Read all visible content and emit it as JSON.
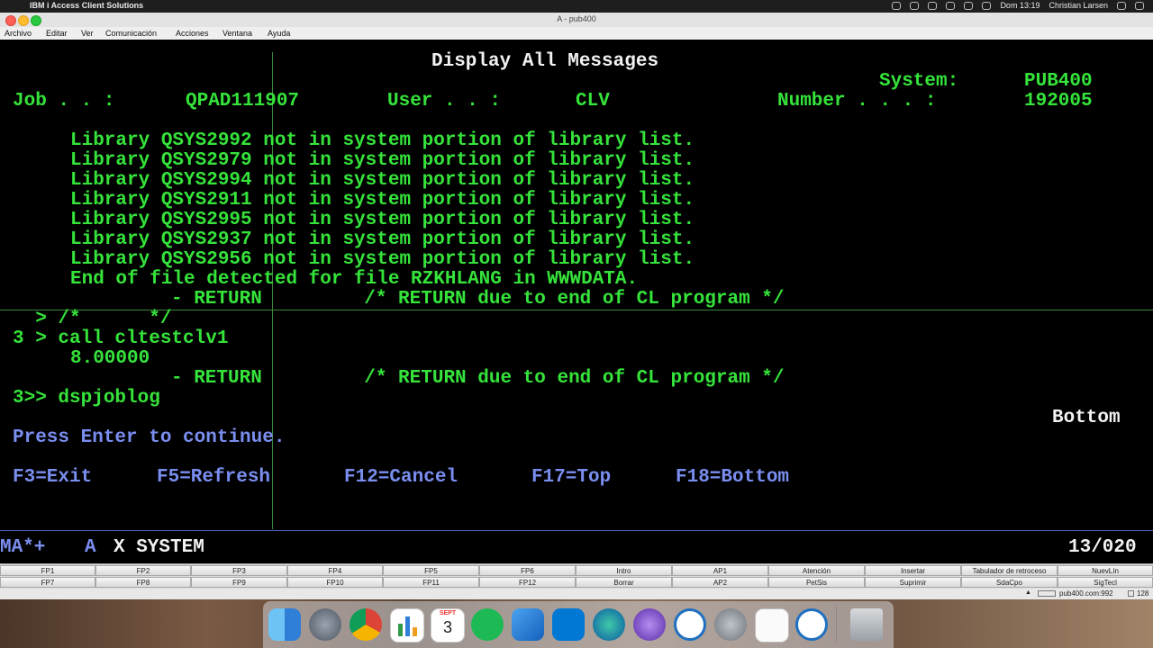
{
  "menubar": {
    "app_name": "IBM i Access Client Solutions",
    "clock": "Dom 13:19",
    "user": "Christian Larsen"
  },
  "window": {
    "title": "A - pub400"
  },
  "appmenu": [
    "Archivo",
    "Editar",
    "Ver",
    "Comunicación",
    "Acciones",
    "Ventana",
    "Ayuda"
  ],
  "screen": {
    "title": "Display All Messages",
    "system_label": "System:",
    "system_value": "PUB400",
    "job_label": "Job . . :",
    "job_value": "QPAD111907",
    "user_label": "User . . :",
    "user_value": "CLV",
    "number_label": "Number . . . :",
    "number_value": "192005",
    "messages": [
      "Library QSYS2992 not in system portion of library list.",
      "Library QSYS2979 not in system portion of library list.",
      "Library QSYS2994 not in system portion of library list.",
      "Library QSYS2911 not in system portion of library list.",
      "Library QSYS2995 not in system portion of library list.",
      "Library QSYS2937 not in system portion of library list.",
      "Library QSYS2956 not in system portion of library list.",
      "End of file detected for file RZKHLANG in WWWDATA."
    ],
    "return_line_1": "- RETURN         /* RETURN due to end of CL program */",
    "comment_line": "  > /*      */",
    "call_line": "3 > call cltestclv1",
    "value_line": "8.00000",
    "return_line_2": "- RETURN         /* RETURN due to end of CL program */",
    "command_line": "3>> dspjoblog",
    "bottom_label": "Bottom",
    "prompt": "Press Enter to continue.",
    "fkeys": [
      "F3=Exit",
      "F5=Refresh",
      "F12=Cancel",
      "F17=Top",
      "F18=Bottom"
    ],
    "status_left": "MA*+",
    "status_a": "A",
    "status_x": "X SYSTEM",
    "status_pos": "13/020"
  },
  "keybar": {
    "row1": [
      "FP1",
      "FP2",
      "FP3",
      "FP4",
      "FP5",
      "FP6",
      "Intro",
      "AP1",
      "Atención",
      "Insertar",
      "Tabulador de retroceso",
      "NuevLín"
    ],
    "row2": [
      "FP7",
      "FP8",
      "FP9",
      "FP10",
      "FP11",
      "FP12",
      "Borrar",
      "AP2",
      "PetSis",
      "Suprimir",
      "SdaCpo",
      "SigTecl"
    ]
  },
  "strip": {
    "host": "pub400.com:992",
    "code": "128"
  },
  "dock": {
    "calendar_month": "SEPT",
    "calendar_day": "3",
    "icons": [
      "finder-icon",
      "launchpad-icon",
      "chrome-icon",
      "numbers-icon",
      "calendar-icon",
      "spotify-icon",
      "xcode-icon",
      "vscode-icon",
      "edge-icon",
      "imovie-icon",
      "ibm-i-access-icon",
      "system-preferences-icon",
      "textedit-icon",
      "ibm-i-access-2-icon",
      "trash-icon"
    ]
  },
  "colors": {
    "green": "#35e33a",
    "white": "#f2f2f2",
    "blue": "#7a8ef0"
  }
}
